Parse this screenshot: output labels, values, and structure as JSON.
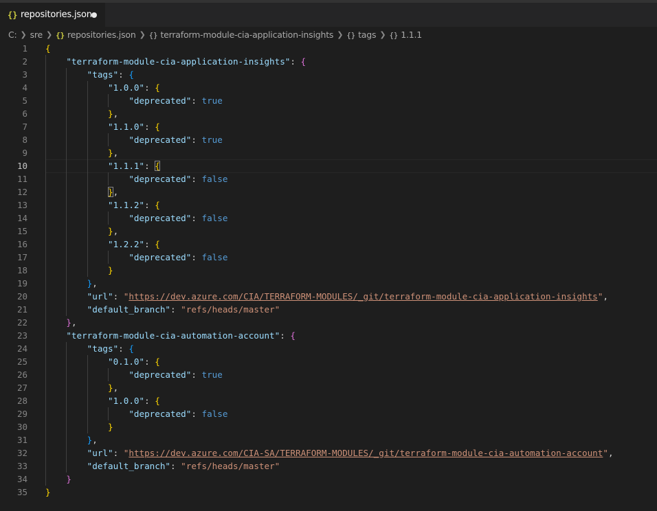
{
  "tab": {
    "icon": "{}",
    "label": "repositories.json",
    "modified": true
  },
  "breadcrumb": {
    "drive": "C:",
    "folder": "sre",
    "file": "repositories.json",
    "file_icon": "{}",
    "obj_icon": "{}",
    "items": [
      "terraform-module-cia-application-insights",
      "tags",
      "1.1.1"
    ]
  },
  "editor": {
    "active_line": 10,
    "lines": [
      {
        "n": "1",
        "indent": 0,
        "t": [
          [
            "{",
            "p1"
          ]
        ]
      },
      {
        "n": "2",
        "indent": 1,
        "t": [
          [
            "\"terraform-module-cia-application-insights\"",
            "k"
          ],
          [
            ": ",
            ""
          ],
          [
            "{",
            "p2"
          ]
        ]
      },
      {
        "n": "3",
        "indent": 2,
        "t": [
          [
            "\"tags\"",
            "k"
          ],
          [
            ": ",
            ""
          ],
          [
            "{",
            "p3"
          ]
        ]
      },
      {
        "n": "4",
        "indent": 3,
        "t": [
          [
            "\"1.0.0\"",
            "k"
          ],
          [
            ": ",
            ""
          ],
          [
            "{",
            "p1"
          ]
        ]
      },
      {
        "n": "5",
        "indent": 4,
        "t": [
          [
            "\"deprecated\"",
            "k"
          ],
          [
            ": ",
            ""
          ],
          [
            "true",
            "b"
          ]
        ]
      },
      {
        "n": "6",
        "indent": 3,
        "t": [
          [
            "}",
            "p1"
          ],
          [
            ",",
            ""
          ]
        ]
      },
      {
        "n": "7",
        "indent": 3,
        "t": [
          [
            "\"1.1.0\"",
            "k"
          ],
          [
            ": ",
            ""
          ],
          [
            "{",
            "p1"
          ]
        ]
      },
      {
        "n": "8",
        "indent": 4,
        "t": [
          [
            "\"deprecated\"",
            "k"
          ],
          [
            ": ",
            ""
          ],
          [
            "true",
            "b"
          ]
        ]
      },
      {
        "n": "9",
        "indent": 3,
        "t": [
          [
            "}",
            "p1"
          ],
          [
            ",",
            ""
          ]
        ]
      },
      {
        "n": "10",
        "indent": 3,
        "t": [
          [
            "\"1.1.1\"",
            "k"
          ],
          [
            ": ",
            ""
          ],
          [
            "{",
            "p1 bm"
          ]
        ]
      },
      {
        "n": "11",
        "indent": 4,
        "t": [
          [
            "\"deprecated\"",
            "k"
          ],
          [
            ": ",
            ""
          ],
          [
            "false",
            "b"
          ]
        ]
      },
      {
        "n": "12",
        "indent": 3,
        "t": [
          [
            "}",
            "p1 bm"
          ],
          [
            ",",
            ""
          ]
        ]
      },
      {
        "n": "13",
        "indent": 3,
        "t": [
          [
            "\"1.1.2\"",
            "k"
          ],
          [
            ": ",
            ""
          ],
          [
            "{",
            "p1"
          ]
        ]
      },
      {
        "n": "14",
        "indent": 4,
        "t": [
          [
            "\"deprecated\"",
            "k"
          ],
          [
            ": ",
            ""
          ],
          [
            "false",
            "b"
          ]
        ]
      },
      {
        "n": "15",
        "indent": 3,
        "t": [
          [
            "}",
            "p1"
          ],
          [
            ",",
            ""
          ]
        ]
      },
      {
        "n": "16",
        "indent": 3,
        "t": [
          [
            "\"1.2.2\"",
            "k"
          ],
          [
            ": ",
            ""
          ],
          [
            "{",
            "p1"
          ]
        ]
      },
      {
        "n": "17",
        "indent": 4,
        "t": [
          [
            "\"deprecated\"",
            "k"
          ],
          [
            ": ",
            ""
          ],
          [
            "false",
            "b"
          ]
        ]
      },
      {
        "n": "18",
        "indent": 3,
        "t": [
          [
            "}",
            "p1"
          ]
        ]
      },
      {
        "n": "19",
        "indent": 2,
        "t": [
          [
            "}",
            "p3"
          ],
          [
            ",",
            ""
          ]
        ]
      },
      {
        "n": "20",
        "indent": 2,
        "t": [
          [
            "\"url\"",
            "k"
          ],
          [
            ": ",
            ""
          ],
          [
            "\"",
            "s"
          ],
          [
            "https://dev.azure.com/CIA/TERRAFORM-MODULES/_git/terraform-module-cia-application-insights",
            "u"
          ],
          [
            "\"",
            "s"
          ],
          [
            ",",
            ""
          ]
        ]
      },
      {
        "n": "21",
        "indent": 2,
        "t": [
          [
            "\"default_branch\"",
            "k"
          ],
          [
            ": ",
            ""
          ],
          [
            "\"refs/heads/master\"",
            "s"
          ]
        ]
      },
      {
        "n": "22",
        "indent": 1,
        "t": [
          [
            "}",
            "p2"
          ],
          [
            ",",
            ""
          ]
        ]
      },
      {
        "n": "23",
        "indent": 1,
        "t": [
          [
            "\"terraform-module-cia-automation-account\"",
            "k"
          ],
          [
            ": ",
            ""
          ],
          [
            "{",
            "p2"
          ]
        ]
      },
      {
        "n": "24",
        "indent": 2,
        "t": [
          [
            "\"tags\"",
            "k"
          ],
          [
            ": ",
            ""
          ],
          [
            "{",
            "p3"
          ]
        ]
      },
      {
        "n": "25",
        "indent": 3,
        "t": [
          [
            "\"0.1.0\"",
            "k"
          ],
          [
            ": ",
            ""
          ],
          [
            "{",
            "p1"
          ]
        ]
      },
      {
        "n": "26",
        "indent": 4,
        "t": [
          [
            "\"deprecated\"",
            "k"
          ],
          [
            ": ",
            ""
          ],
          [
            "true",
            "b"
          ]
        ]
      },
      {
        "n": "27",
        "indent": 3,
        "t": [
          [
            "}",
            "p1"
          ],
          [
            ",",
            ""
          ]
        ]
      },
      {
        "n": "28",
        "indent": 3,
        "t": [
          [
            "\"1.0.0\"",
            "k"
          ],
          [
            ": ",
            ""
          ],
          [
            "{",
            "p1"
          ]
        ]
      },
      {
        "n": "29",
        "indent": 4,
        "t": [
          [
            "\"deprecated\"",
            "k"
          ],
          [
            ": ",
            ""
          ],
          [
            "false",
            "b"
          ]
        ]
      },
      {
        "n": "30",
        "indent": 3,
        "t": [
          [
            "}",
            "p1"
          ]
        ]
      },
      {
        "n": "31",
        "indent": 2,
        "t": [
          [
            "}",
            "p3"
          ],
          [
            ",",
            ""
          ]
        ]
      },
      {
        "n": "32",
        "indent": 2,
        "t": [
          [
            "\"url\"",
            "k"
          ],
          [
            ": ",
            ""
          ],
          [
            "\"",
            "s"
          ],
          [
            "https://dev.azure.com/CIA-SA/TERRAFORM-MODULES/_git/terraform-module-cia-automation-account",
            "u"
          ],
          [
            "\"",
            "s"
          ],
          [
            ",",
            ""
          ]
        ]
      },
      {
        "n": "33",
        "indent": 2,
        "t": [
          [
            "\"default_branch\"",
            "k"
          ],
          [
            ": ",
            ""
          ],
          [
            "\"refs/heads/master\"",
            "s"
          ]
        ]
      },
      {
        "n": "34",
        "indent": 1,
        "t": [
          [
            "}",
            "p2"
          ]
        ]
      },
      {
        "n": "35",
        "indent": 0,
        "t": [
          [
            "}",
            "p1"
          ]
        ]
      }
    ]
  }
}
